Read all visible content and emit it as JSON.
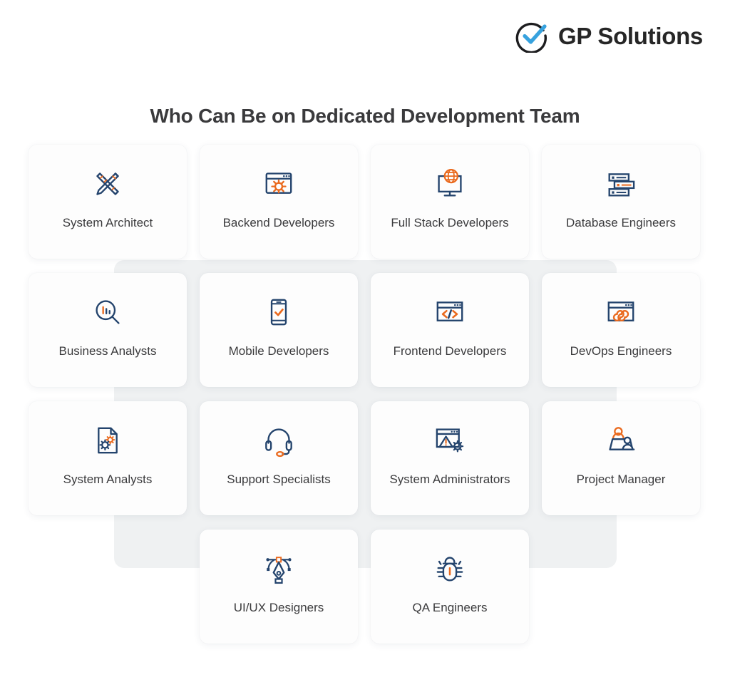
{
  "brand": {
    "logo_icon": "check-circle-icon",
    "name": "GP Solutions",
    "logo_circle_color": "#1d1d1f",
    "logo_check_color": "#37a2de"
  },
  "header": {
    "title": "Who Can Be on Dedicated Development Team"
  },
  "colors": {
    "navy": "#24446d",
    "orange": "#ea6a1e",
    "text": "#3b3b3d",
    "card_bg": "#fdfdfd",
    "backdrop": "#eceef0",
    "page_bg": "#ffffff"
  },
  "grid": {
    "columns": 4,
    "cards": [
      {
        "label": "System Architect",
        "icon": "ruler-pencil-icon"
      },
      {
        "label": "Backend Developers",
        "icon": "browser-gear-icon"
      },
      {
        "label": "Full Stack Developers",
        "icon": "monitor-globe-icon"
      },
      {
        "label": "Database Engineers",
        "icon": "server-stack-icon"
      },
      {
        "label": "Business Analysts",
        "icon": "magnifier-chart-icon"
      },
      {
        "label": "Mobile Developers",
        "icon": "phone-check-icon"
      },
      {
        "label": "Frontend Developers",
        "icon": "browser-code-icon"
      },
      {
        "label": "DevOps Engineers",
        "icon": "browser-infinity-icon"
      },
      {
        "label": "System Analysts",
        "icon": "document-gears-icon"
      },
      {
        "label": "Support Specialists",
        "icon": "headset-icon"
      },
      {
        "label": "System Administrators",
        "icon": "browser-warning-gear-icon"
      },
      {
        "label": "Project Manager",
        "icon": "people-desk-icon"
      },
      {
        "label": "UI/UX Designers",
        "icon": "pen-tool-icon"
      },
      {
        "label": "QA Engineers",
        "icon": "bug-icon"
      }
    ]
  }
}
